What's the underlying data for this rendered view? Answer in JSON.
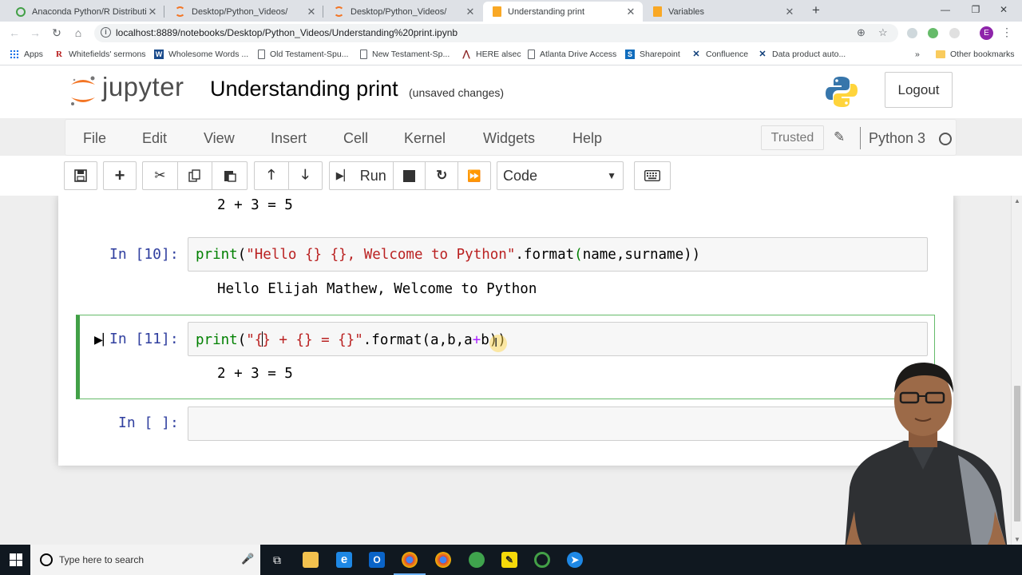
{
  "browser": {
    "tabs": [
      {
        "title": "Anaconda Python/R Distribution",
        "icon": "anaconda-icon"
      },
      {
        "title": "Desktop/Python_Videos/",
        "icon": "jupyter-icon"
      },
      {
        "title": "Desktop/Python_Videos/",
        "icon": "jupyter-icon"
      },
      {
        "title": "Understanding print",
        "icon": "notebook-icon",
        "active": true
      },
      {
        "title": "Variables",
        "icon": "notebook-icon"
      }
    ],
    "url": "localhost:8889/notebooks/Desktop/Python_Videos/Understanding%20print.ipynb",
    "profile_initial": "E",
    "bookmarks": [
      {
        "label": "Apps",
        "icon": "apps-icon"
      },
      {
        "label": "Whitefields' sermons",
        "icon": "r-icon"
      },
      {
        "label": "Wholesome Words ...",
        "icon": "w-icon"
      },
      {
        "label": "Old Testament-Spu...",
        "icon": "page-icon"
      },
      {
        "label": "New Testament-Sp...",
        "icon": "page-icon"
      },
      {
        "label": "HERE alsec",
        "icon": "here-icon"
      },
      {
        "label": "Atlanta Drive Access",
        "icon": "page-icon"
      },
      {
        "label": "Sharepoint",
        "icon": "sharepoint-icon"
      },
      {
        "label": "Confluence",
        "icon": "x-icon"
      },
      {
        "label": "Data product auto...",
        "icon": "x-icon"
      }
    ],
    "more_bookmarks": "»",
    "other_bookmarks": "Other bookmarks"
  },
  "jupyter": {
    "logo_text": "jupyter",
    "notebook_title": "Understanding print",
    "save_status": "(unsaved changes)",
    "logout_label": "Logout",
    "menus": [
      "File",
      "Edit",
      "View",
      "Insert",
      "Cell",
      "Kernel",
      "Widgets",
      "Help"
    ],
    "trusted_label": "Trusted",
    "kernel_name": "Python 3",
    "run_label": "Run",
    "cell_type": "Code"
  },
  "cells": [
    {
      "output": "2 + 3 = 5"
    },
    {
      "prompt": "In [10]:",
      "code_parts": {
        "fn": "print",
        "open": "(",
        "str": "\"Hello {} {}, Welcome to Python\"",
        "dot": ".format",
        "open2": "(",
        "args": "name,surname",
        "close": "))"
      },
      "output": "Hello Elijah Mathew, Welcome to Python"
    },
    {
      "prompt": "In [11]:",
      "code_parts": {
        "fn": "print",
        "open": "(",
        "str_a": "\"{",
        "str_b": "} + {} = {}\"",
        "dot": ".format(a,b,a",
        "op": "+",
        "tail": "b))"
      },
      "output": "2 + 3 = 5"
    },
    {
      "prompt": "In [ ]:"
    }
  ],
  "taskbar": {
    "search_placeholder": "Type here to search"
  }
}
